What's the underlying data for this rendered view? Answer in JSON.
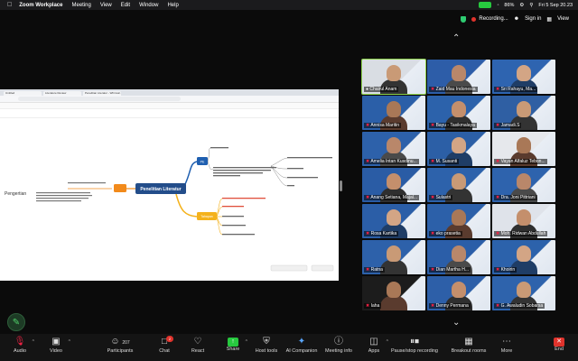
{
  "menubar": {
    "app": "Zoom Workplace",
    "items": [
      "Meeting",
      "View",
      "Edit",
      "Window",
      "Help"
    ],
    "battery": "86%",
    "datetime": "Fri 5 Sep  20.23"
  },
  "zoom_top": {
    "recording": "Recording...",
    "sign_in": "Sign in",
    "view": "View"
  },
  "shared_screen": {
    "browser_tabs": [
      "Untitled",
      "Literature Review",
      "Penelitian Literatur - Whimsic..."
    ],
    "mindmap": {
      "center": "Penelitian Literatur",
      "left_labels": [
        "Pengertian",
        "Definisi"
      ],
      "top_node": "PE",
      "bottom_node": "Tahapan",
      "right_items_top": [
        "Kajian teori",
        "Review literatur",
        "Analisis sistematis",
        "Referensi"
      ],
      "right_items_bottom": [
        "Identifikasi topik",
        "Cari sumber",
        "Seleksi data",
        "Analisis data",
        "Sintesis hasil"
      ],
      "colors": {
        "center": "#234d8a",
        "orange": "#f28a1b",
        "blue_branch": "#1f5fb0",
        "yellow_branch": "#f4b21c"
      }
    }
  },
  "participants": [
    {
      "name": "Chairul Anam",
      "muted": false,
      "active": true,
      "video": true,
      "bg": "#d9dde3"
    },
    {
      "name": "Zaid Mau Indonesia",
      "muted": true,
      "video": true,
      "bg": "#2d5da8"
    },
    {
      "name": "Sri Rahayu, Ma...",
      "muted": true,
      "video": true,
      "bg": "#2e64b0"
    },
    {
      "name": "Annisa Maritin",
      "muted": true,
      "video": true,
      "bg": "#2b5fa8"
    },
    {
      "name": "Bayu - Tasikmalaya",
      "muted": true,
      "video": true,
      "bg": "#2c62ab"
    },
    {
      "name": "Jamadi.S",
      "muted": true,
      "video": true,
      "bg": "#2f5fa3"
    },
    {
      "name": "Amelia Intan Kusdinu...",
      "muted": true,
      "video": true,
      "bg": "#2d61aa"
    },
    {
      "name": "M. Susanti",
      "muted": true,
      "video": true,
      "bg": "#2c5fa6"
    },
    {
      "name": "Vayan Alfaluz Tebon...",
      "muted": true,
      "video": true,
      "bg": "#e6e8ec"
    },
    {
      "name": "Anang Setiana, Majal...",
      "muted": true,
      "video": true,
      "bg": "#2a5ca5"
    },
    {
      "name": "Sulastri",
      "muted": true,
      "video": true,
      "bg": "#2d62ab"
    },
    {
      "name": "Dra. Joni Pittriani",
      "muted": true,
      "video": true,
      "bg": "#2e63ad"
    },
    {
      "name": "Rosa Kartika",
      "muted": true,
      "video": true,
      "bg": "#2b5ea7"
    },
    {
      "name": "eko prasetia",
      "muted": true,
      "video": true,
      "bg": "#2c60a9"
    },
    {
      "name": "Moh. Ridwan Abdullah",
      "muted": true,
      "video": true,
      "bg": "#dfe3ea"
    },
    {
      "name": "Ratna",
      "muted": true,
      "video": true,
      "bg": "#2d61aa"
    },
    {
      "name": "Dian Martha H...",
      "muted": true,
      "video": true,
      "bg": "#2b5ea8"
    },
    {
      "name": "Khoirin",
      "muted": true,
      "video": true,
      "bg": "#2c62ab"
    },
    {
      "name": "Iaha",
      "muted": true,
      "video": true,
      "bg": "#1c1c1c"
    },
    {
      "name": "Denny Permana",
      "muted": true,
      "video": true,
      "bg": "#2d5fa8"
    },
    {
      "name": "G. Awaludin Sobarsa",
      "muted": true,
      "video": true,
      "bg": "#2e63ac"
    }
  ],
  "toolbar": {
    "audio": "Audio",
    "video": "Video",
    "participants": "Participants",
    "participants_count": "207",
    "chat": "Chat",
    "chat_badge": "2",
    "react": "React",
    "share": "Share",
    "host_tools": "Host tools",
    "ai_companion": "AI Companion",
    "meeting_info": "Meeting info",
    "apps": "Apps",
    "pause_recording": "Pause/stop recording",
    "breakout_rooms": "Breakout rooms",
    "more": "More",
    "end": "End"
  }
}
